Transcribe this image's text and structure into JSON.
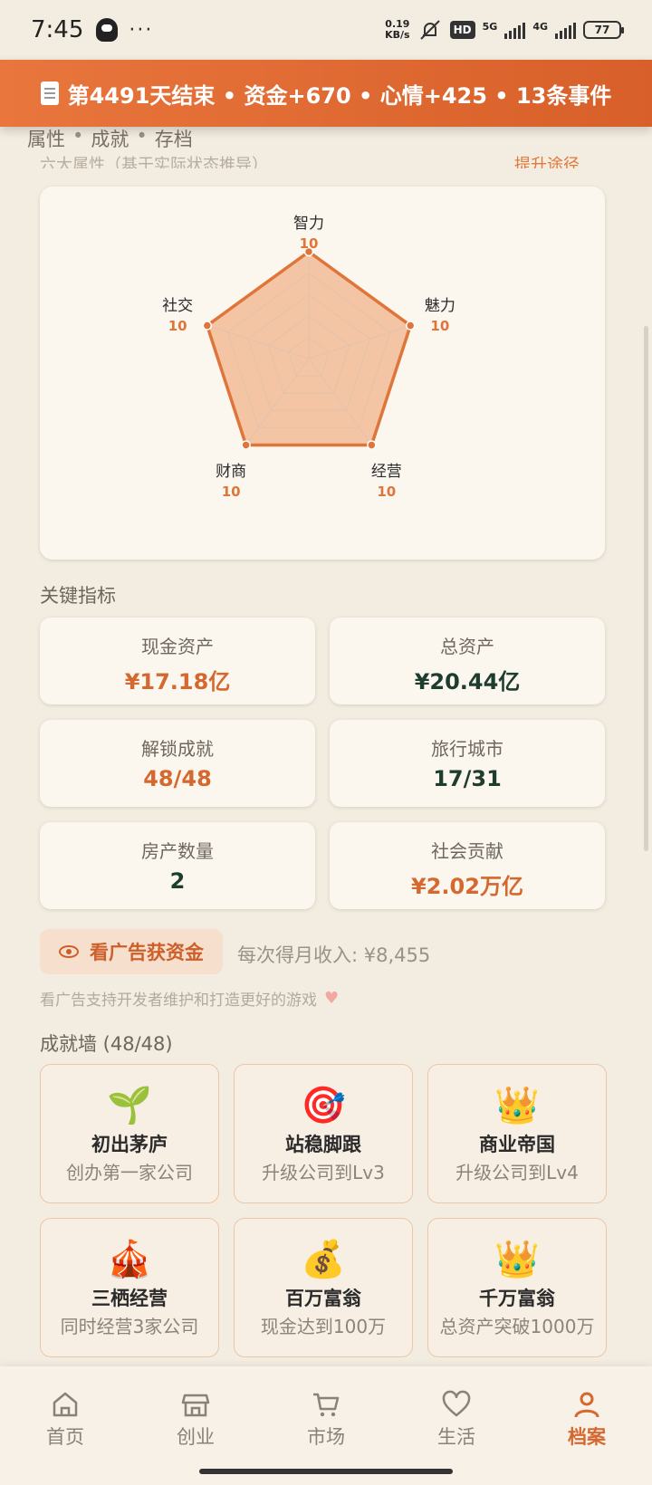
{
  "status_bar": {
    "time": "7:45",
    "net_speed_value": "0.19",
    "net_speed_unit": "KB/s",
    "hd": "HD",
    "sig1": "5G",
    "sig2": "4G",
    "battery": "77"
  },
  "banner": {
    "text": "第4491天结束 • 资金+670 • 心情+425 • 13条事件"
  },
  "tabs": [
    "属性",
    "成就",
    "存档"
  ],
  "tab_sep": "•",
  "partial": {
    "heading": "六大属性（基于实际状态推导）",
    "link": "提升途径"
  },
  "radar": {
    "attributes": [
      {
        "name": "智力",
        "value": 10
      },
      {
        "name": "魅力",
        "value": 10
      },
      {
        "name": "经营",
        "value": 10
      },
      {
        "name": "财商",
        "value": 10
      },
      {
        "name": "社交",
        "value": 10
      }
    ],
    "max": 10,
    "colors": {
      "fill": "#f0b48c",
      "stroke": "#e0753a",
      "grid": "#e3c2ab"
    }
  },
  "key_metrics": {
    "title": "关键指标",
    "items": [
      {
        "label": "现金资产",
        "value": "¥17.18亿",
        "tone": "orange"
      },
      {
        "label": "总资产",
        "value": "¥20.44亿",
        "tone": "green"
      },
      {
        "label": "解锁成就",
        "value": "48/48",
        "tone": "orange"
      },
      {
        "label": "旅行城市",
        "value": "17/31",
        "tone": "green"
      },
      {
        "label": "房产数量",
        "value": "2",
        "tone": "green"
      },
      {
        "label": "社会贡献",
        "value": "¥2.02万亿",
        "tone": "orange"
      }
    ]
  },
  "ad": {
    "button": "看广告获资金",
    "income": "每次得月收入: ¥8,455",
    "note": "看广告支持开发者维护和打造更好的游戏",
    "heart": "♥"
  },
  "achievements": {
    "title": "成就墙 (48/48)",
    "items": [
      {
        "emoji": "🌱",
        "title": "初出茅庐",
        "desc": "创办第一家公司"
      },
      {
        "emoji": "🎯",
        "title": "站稳脚跟",
        "desc": "升级公司到Lv3"
      },
      {
        "emoji": "👑",
        "title": "商业帝国",
        "desc": "升级公司到Lv4"
      },
      {
        "emoji": "🎪",
        "title": "三栖经营",
        "desc": "同时经营3家公司"
      },
      {
        "emoji": "💰",
        "title": "百万富翁",
        "desc": "现金达到100万"
      },
      {
        "emoji": "👑",
        "title": "千万富翁",
        "desc": "总资产突破1000万"
      }
    ]
  },
  "nav": {
    "items": [
      {
        "label": "首页",
        "icon": "home-icon"
      },
      {
        "label": "创业",
        "icon": "shop-icon"
      },
      {
        "label": "市场",
        "icon": "cart-icon"
      },
      {
        "label": "生活",
        "icon": "heart-icon"
      },
      {
        "label": "档案",
        "icon": "person-icon",
        "active": true
      }
    ],
    "active_color": "#d4682f"
  }
}
